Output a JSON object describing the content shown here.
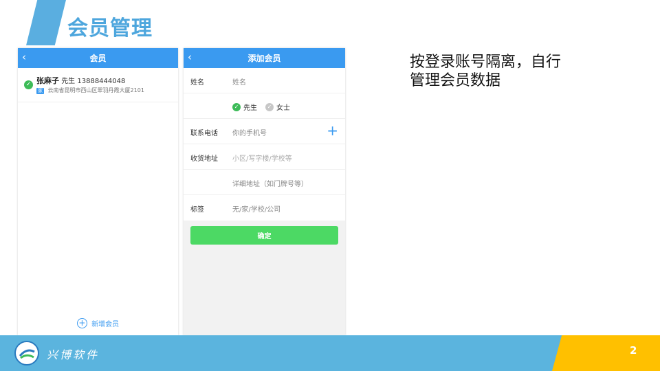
{
  "slide": {
    "title": "会员管理",
    "page_number": "2",
    "brand": "兴博软件"
  },
  "left_panel": {
    "nav_title": "会员",
    "back_icon": "chevron-left-icon",
    "member": {
      "name": "张麻子",
      "gender": "先生",
      "phone": "13888444048",
      "address_tag": "家",
      "address": "云南省昆明市西山区翠羽丹霞大厦2101"
    },
    "add_member_label": "新增会员"
  },
  "right_panel": {
    "nav_title": "添加会员",
    "fields": {
      "name_label": "姓名",
      "name_placeholder": "姓名",
      "gender_male": "先生",
      "gender_female": "女士",
      "phone_label": "联系电话",
      "phone_placeholder": "你的手机号",
      "address_label": "收货地址",
      "area_placeholder": "小区/写字楼/学校等",
      "detail_placeholder": "详细地址（如门牌号等）",
      "tag_label": "标签",
      "tag_placeholder": "无/家/学校/公司"
    },
    "confirm_label": "确定"
  },
  "description": {
    "line1": "按登录账号隔离，自行",
    "line2": "管理会员数据"
  },
  "colors": {
    "nav_blue": "#3a9af0",
    "title_blue": "#4da6dd",
    "confirm_green": "#4cd964",
    "footer_blue": "#5bb4de",
    "footer_yellow": "#ffc000"
  }
}
